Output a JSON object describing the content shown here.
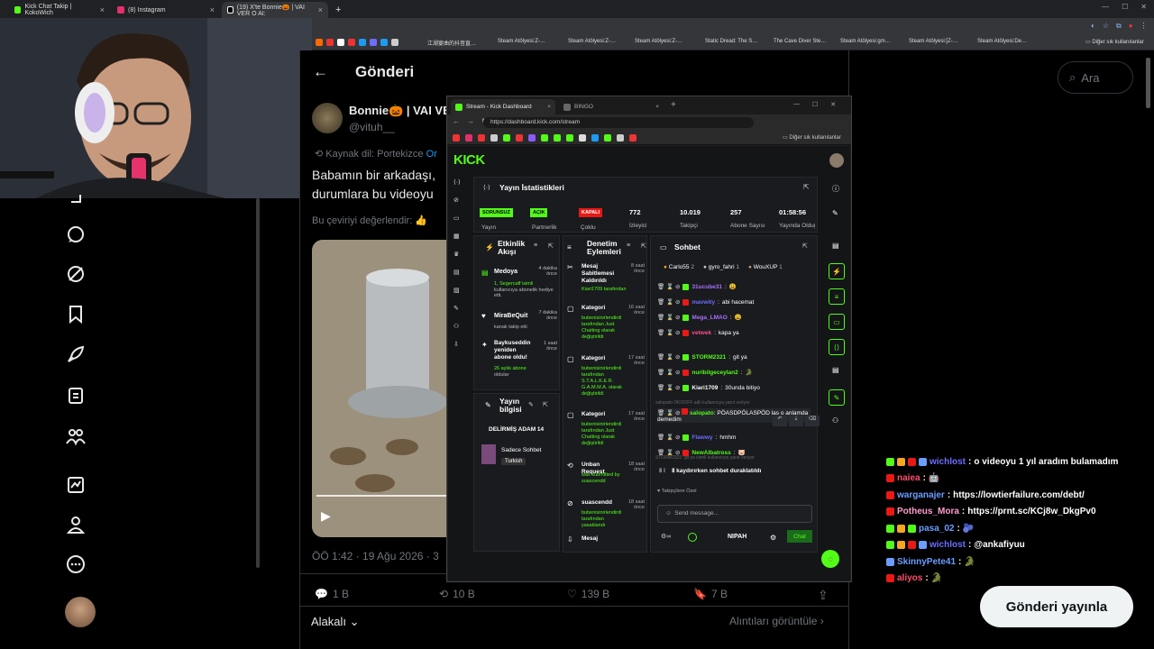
{
  "outer_browser": {
    "tabs": [
      {
        "label": "Kick Chat Takip | KokoWich"
      },
      {
        "label": "(8) Instagram"
      },
      {
        "label": "(19) X'te Bonnie🎃 | VAI VER O AI:"
      }
    ],
    "bookmarks": [
      "江湖宴曲的抖音直…",
      "Steam Atölyesi:Z-…",
      "Steam Atölyesi:Z-…",
      "Steam Atölyesi:Z-…",
      "Static Dread: The S…",
      "The Cave Diver Ste…",
      "Steam Atölyesi:gm…",
      "Steam Atölyesi:[Z-…",
      "Steam Atölyesi:De…"
    ],
    "bookmarks_folder": "Diğer sık kullanılanlar"
  },
  "x": {
    "header_title": "Gönderi",
    "search_placeholder": "Ara",
    "author_name": "Bonnie🎃 | VAI VE",
    "author_handle": "@vituh__",
    "source_lang": "Kaynak dil: Portekizce",
    "source_lang_link": "Or",
    "text_line1": "Babamın bir arkadaşı,",
    "text_line2": "durumlara bu videoyu",
    "rate_translation": "Bu çeviriyi değerlendir:",
    "timestamp": "ÖÖ 1:42 · 19 Ağu 2026 · 3",
    "replies": "1 B",
    "reposts": "10 B",
    "likes": "139 B",
    "bookmarks": "7 B",
    "relevant": "Alakalı",
    "view_quotes": "Alıntıları görüntüle",
    "post_button": "Gönderi yayınla"
  },
  "inner_browser": {
    "tab1": "Stream - Kick Dashboard",
    "tab2": "BINGO",
    "url": "https://dashboard.kick.com/stream",
    "bookmarks_folder": "Diğer sık kullanılanlar"
  },
  "kick": {
    "logo": "KICK",
    "stats_title": "Yayın İstatistikleri",
    "stats": [
      {
        "badge": "SORUNSUZ",
        "label": "Yayın"
      },
      {
        "badge": "AÇIK",
        "label": "Partnerlik"
      },
      {
        "badge": "KAPALI",
        "label": "Çoklu"
      },
      {
        "value": "772",
        "label": "İzleyici"
      },
      {
        "value": "10.019",
        "label": "Takipçi"
      },
      {
        "value": "257",
        "label": "Abone Sayısı"
      },
      {
        "value": "01:58:56",
        "label": "Yayında Olduğu"
      }
    ],
    "activity_title": "Etkinlik Akışı",
    "activity": [
      {
        "name": "Medoya",
        "time": "4 dakika önce",
        "desc1": "1, Segercaff isimli",
        "desc2": "kullanıcıya abonelik hediye etti."
      },
      {
        "name": "MiraBeQuit",
        "time": "7 dakika önce",
        "desc1": "kanalı takip etti",
        "desc2": ""
      },
      {
        "name": "Baykuseddin yeniden abone oldu!",
        "time": "1 saat önce",
        "desc1": "26 aylık abone",
        "desc2": "oldular"
      }
    ],
    "mod_title": "Denetim Eylemleri",
    "mod": [
      {
        "name": "Mesaj Sabitlemesi Kaldırıldı",
        "time": "8 saat önce",
        "desc": "Kiari1709 tarafından"
      },
      {
        "name": "Kategori",
        "time": "16 saat önce",
        "desc": "bubenisinirlendirdi tarafından Just Chatting olarak değiştirildi"
      },
      {
        "name": "Kategori",
        "time": "17 saat önce",
        "desc": "bubenisinirlendirdi tarafından S.T.A.L.K.E.R. G.A.M.M.A. olarak değiştirildi"
      },
      {
        "name": "Kategori",
        "time": "17 saat önce",
        "desc": "bubenisinirlendirdi tarafından Just Chatting olarak değiştirildi"
      },
      {
        "name": "Unban Request",
        "time": "18 saat önce",
        "desc": "was submitted by suascendd"
      },
      {
        "name": "suascendd",
        "time": "18 saat önce",
        "desc": "bubenisinirlendirdi tarafından yasaklandı"
      },
      {
        "name": "Mesaj",
        "time": "",
        "desc": ""
      }
    ],
    "info_title": "Yayın bilgisi",
    "info_stream_title": "DELİRMİŞ ADAM 14",
    "info_category": "Sadece Sohbet",
    "info_lang": "Turkish",
    "chat_title": "Sohbet",
    "top_gifters": [
      {
        "name": "Carlo55",
        "count": "2"
      },
      {
        "name": "gyro_fahri",
        "count": "1"
      },
      {
        "name": "WouXUP",
        "count": "1"
      }
    ],
    "chat": [
      {
        "user": "31ucube31",
        "msg": "😩",
        "color": "#a970ff"
      },
      {
        "user": "mavwity",
        "msg": "abi hacemat",
        "color": "#6d6dff"
      },
      {
        "user": "Mega_LMAO",
        "msg": "😩",
        "color": "#a970ff"
      },
      {
        "user": "vetwek",
        "msg": "kapa ya",
        "color": "#ff4f8b"
      },
      {
        "user": "STORM2321",
        "msg": "git ya",
        "color": "#53fc18"
      },
      {
        "user": "nuribilgeceylan2",
        "msg": "🐊",
        "color": "#53fc18"
      },
      {
        "user": "Kiari1709",
        "msg": "30unda bitiyo",
        "color": "#ffffff"
      },
      {
        "user": "salopato",
        "msg": "PÖASDPÖLASPÖD las o anlamda demedim",
        "color": "#53fc18"
      },
      {
        "user": "Flawwy",
        "msg": "hmhm",
        "color": "#6d6dff"
      },
      {
        "user": "NewAlbatross",
        "msg": "🐷",
        "color": "#53fc18"
      }
    ],
    "system1": "salopato OKOOFF adlı kullanıcıya yanıt veriyor",
    "system2": "STORM2321: git ya isimli kullanıcıya yanıt veriyor",
    "paused": "kaydırırken sohbet duraklatıldı",
    "followers_only": "Takipçilere Özel",
    "send_placeholder": "Send message...",
    "nipah": "NIPAH",
    "chat_button": "Chat"
  },
  "right_chat": [
    {
      "user": "wichlost",
      "msg": "o videoyu 1 yıl aradım bulamadım",
      "color": "#6d6dff"
    },
    {
      "user": "naiea",
      "msg": "🤖",
      "color": "#ff4f6b"
    },
    {
      "user": "warganajer",
      "msg": "https://lowtierfailure.com/debt/",
      "color": "#6d9dff"
    },
    {
      "user": "Potheus_Mora",
      "msg": "https://prnt.sc/KCj8w_DkgPv0",
      "color": "#ff9fd0"
    },
    {
      "user": "pasa_02",
      "msg": "🫐",
      "color": "#6d9dff"
    },
    {
      "user": "wichlost",
      "msg": "@ankafiyuu",
      "color": "#6d6dff"
    },
    {
      "user": "SkinnyPete41",
      "msg": "🐊",
      "color": "#6d9dff"
    },
    {
      "user": "aliyos",
      "msg": "🐊",
      "color": "#ff4f6b"
    }
  ],
  "colors": {
    "kick_green": "#53fc18",
    "x_accent": "#1d9bf0",
    "red_badge": "#e91916"
  }
}
